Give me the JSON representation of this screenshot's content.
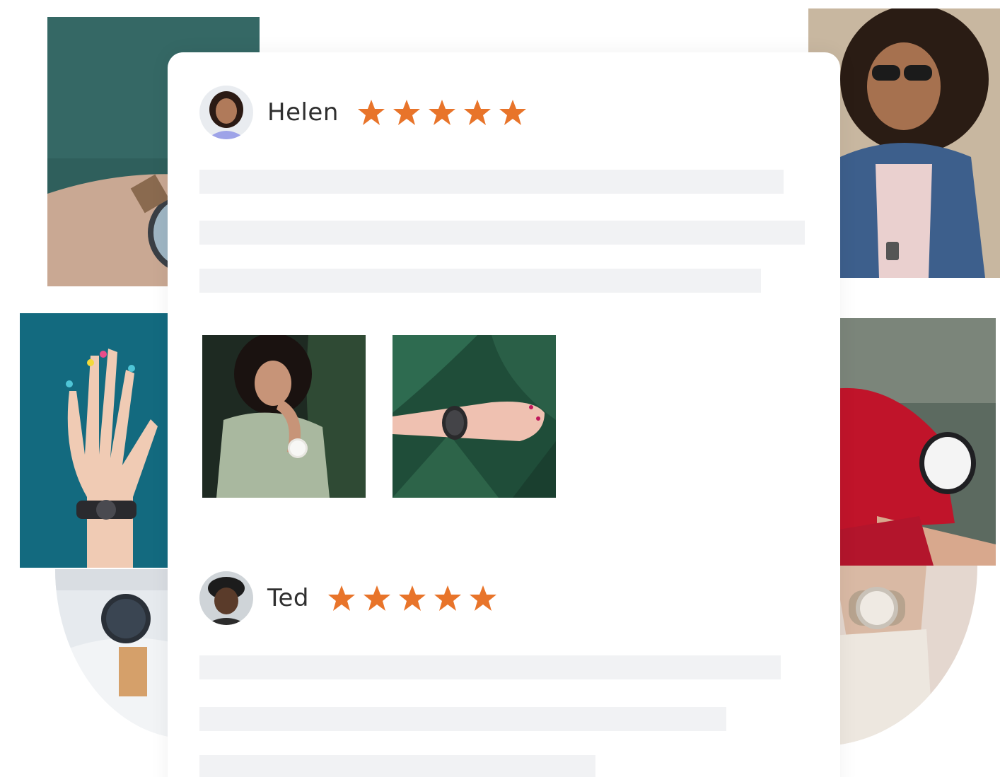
{
  "reviews": [
    {
      "name": "Helen",
      "rating": 5,
      "rating_max": 5,
      "photo_count": 2
    },
    {
      "name": "Ted",
      "rating": 5,
      "rating_max": 5
    }
  ],
  "colors": {
    "star": "#e8742a",
    "placeholder_line": "#f1f2f4",
    "card_background": "#ffffff",
    "name_text": "#2f2f2f"
  },
  "icons": {
    "star": "star-icon"
  }
}
